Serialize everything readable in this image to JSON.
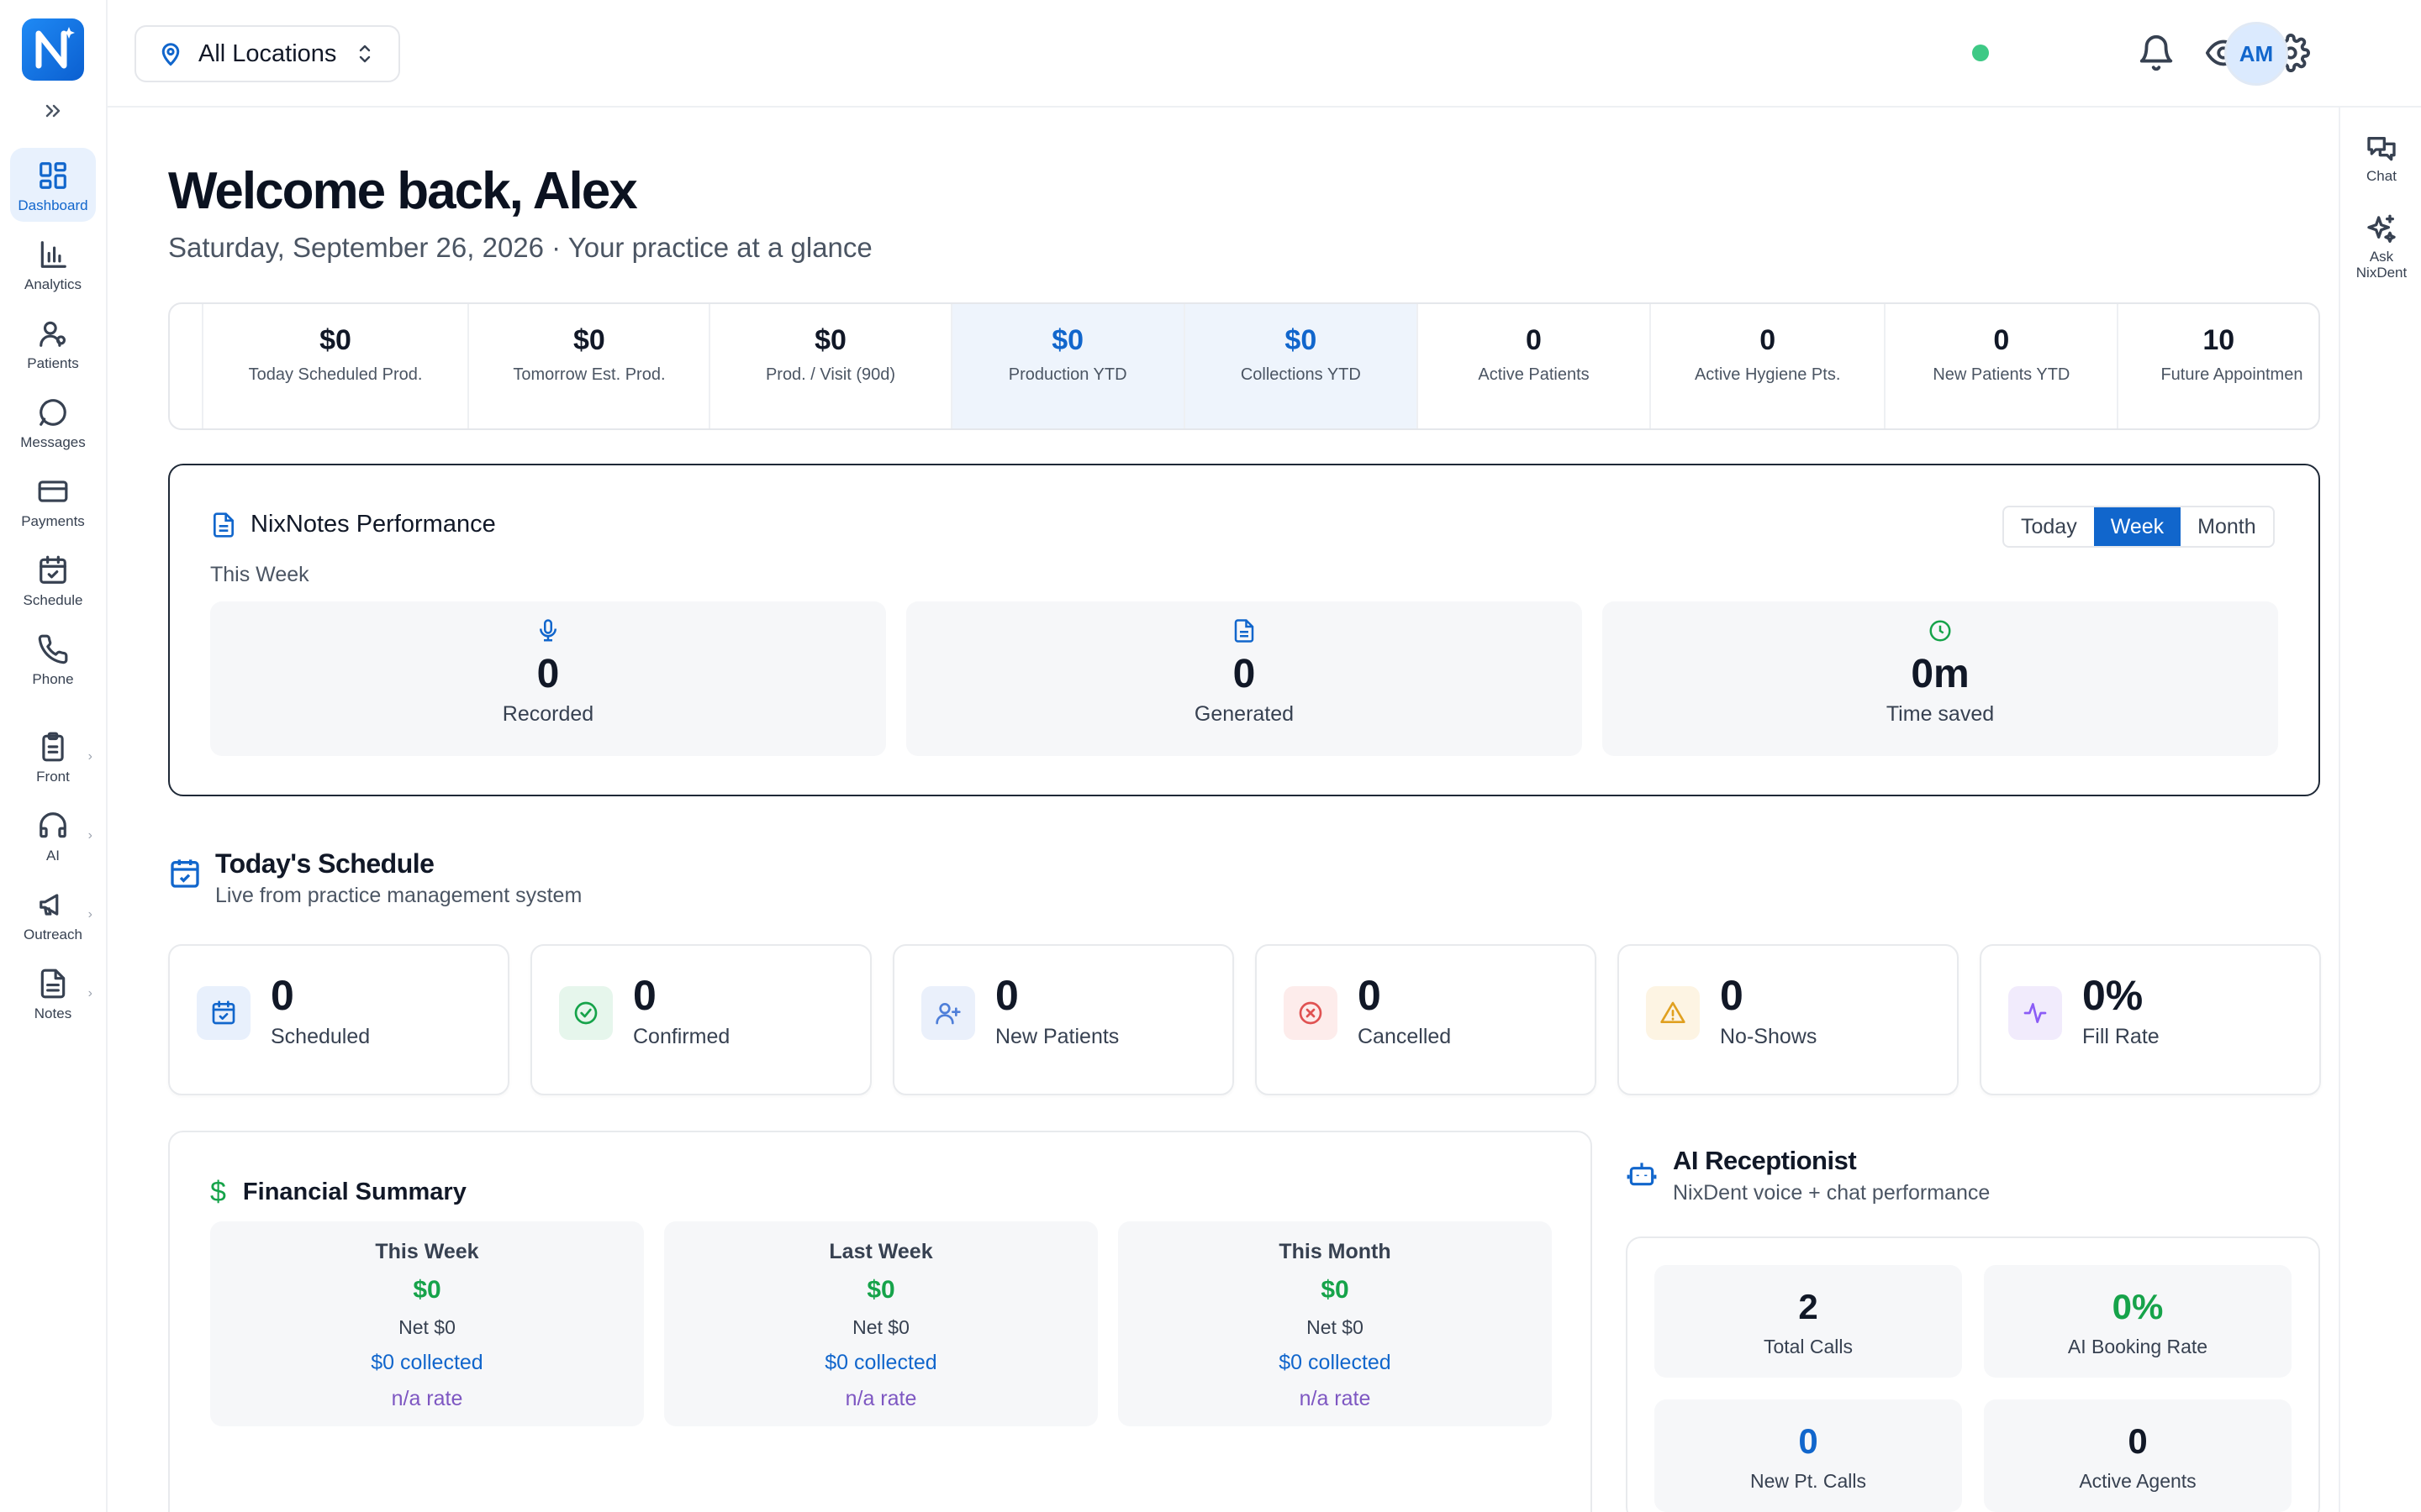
{
  "sidebar": {
    "items": [
      {
        "label": "Dashboard",
        "icon": "dashboard-icon",
        "active": true
      },
      {
        "label": "Analytics",
        "icon": "analytics-icon"
      },
      {
        "label": "Patients",
        "icon": "patients-icon"
      },
      {
        "label": "Messages",
        "icon": "messages-icon"
      },
      {
        "label": "Payments",
        "icon": "payments-icon"
      },
      {
        "label": "Schedule",
        "icon": "schedule-icon"
      },
      {
        "label": "Phone",
        "icon": "phone-icon"
      },
      {
        "label": "Front",
        "icon": "clipboard-icon"
      },
      {
        "label": "AI",
        "icon": "headset-icon"
      },
      {
        "label": "Outreach",
        "icon": "megaphone-icon"
      },
      {
        "label": "Notes",
        "icon": "notes-icon"
      }
    ]
  },
  "header": {
    "location": "All Locations",
    "avatar_initials": "AM",
    "status_color": "#3ec985"
  },
  "right_rail": {
    "chat_label": "Chat",
    "ask_label_1": "Ask",
    "ask_label_2": "NixDent"
  },
  "page": {
    "title": "Welcome back, Alex",
    "subtitle": "Saturday, September 26, 2026 · Your practice at a glance"
  },
  "kpis": [
    {
      "value": "$0",
      "label": "Today Scheduled Prod."
    },
    {
      "value": "$0",
      "label": "Tomorrow Est. Prod."
    },
    {
      "value": "$0",
      "label": "Prod. / Visit (90d)"
    },
    {
      "value": "$0",
      "label": "Production YTD",
      "highlight": true
    },
    {
      "value": "$0",
      "label": "Collections YTD",
      "highlight": true
    },
    {
      "value": "0",
      "label": "Active Patients"
    },
    {
      "value": "0",
      "label": "Active Hygiene Pts."
    },
    {
      "value": "0",
      "label": "New Patients YTD"
    },
    {
      "value": "10",
      "label": "Future Appointmen"
    }
  ],
  "nixnotes": {
    "title": "NixNotes Performance",
    "period_label": "This Week",
    "tabs": [
      "Today",
      "Week",
      "Month"
    ],
    "selected_tab": "Week",
    "cards": [
      {
        "value": "0",
        "label": "Recorded",
        "icon": "mic-icon"
      },
      {
        "value": "0",
        "label": "Generated",
        "icon": "document-icon"
      },
      {
        "value": "0m",
        "label": "Time saved",
        "icon": "clock-icon"
      }
    ]
  },
  "schedule": {
    "title": "Today's Schedule",
    "subtitle": "Live from practice management system",
    "stats": [
      {
        "value": "0",
        "label": "Scheduled",
        "icon": "calendar-check-icon",
        "color": "#1166cc"
      },
      {
        "value": "0",
        "label": "Confirmed",
        "icon": "check-circle-icon",
        "color": "#16a34a"
      },
      {
        "value": "0",
        "label": "New Patients",
        "icon": "user-plus-icon",
        "color": "#4f7fd9"
      },
      {
        "value": "0",
        "label": "Cancelled",
        "icon": "x-circle-icon",
        "color": "#e05252"
      },
      {
        "value": "0",
        "label": "No-Shows",
        "icon": "warning-icon",
        "color": "#e0a020"
      },
      {
        "value": "0%",
        "label": "Fill Rate",
        "icon": "activity-icon",
        "color": "#8b5cf6"
      }
    ]
  },
  "financial": {
    "title": "Financial Summary",
    "cards": [
      {
        "period": "This Week",
        "amount": "$0",
        "net": "Net $0",
        "collected": "$0 collected",
        "rate": "n/a rate"
      },
      {
        "period": "Last Week",
        "amount": "$0",
        "net": "Net $0",
        "collected": "$0 collected",
        "rate": "n/a rate"
      },
      {
        "period": "This Month",
        "amount": "$0",
        "net": "Net $0",
        "collected": "$0 collected",
        "rate": "n/a rate"
      }
    ]
  },
  "ai_receptionist": {
    "title": "AI Receptionist",
    "subtitle": "NixDent voice + chat performance",
    "cards": [
      {
        "value": "2",
        "label": "Total Calls",
        "color": "#111827"
      },
      {
        "value": "0%",
        "label": "AI Booking Rate",
        "color": "#16a34a"
      },
      {
        "value": "0",
        "label": "New Pt. Calls",
        "color": "#1166cc"
      },
      {
        "value": "0",
        "label": "Active Agents",
        "color": "#111827"
      }
    ]
  }
}
